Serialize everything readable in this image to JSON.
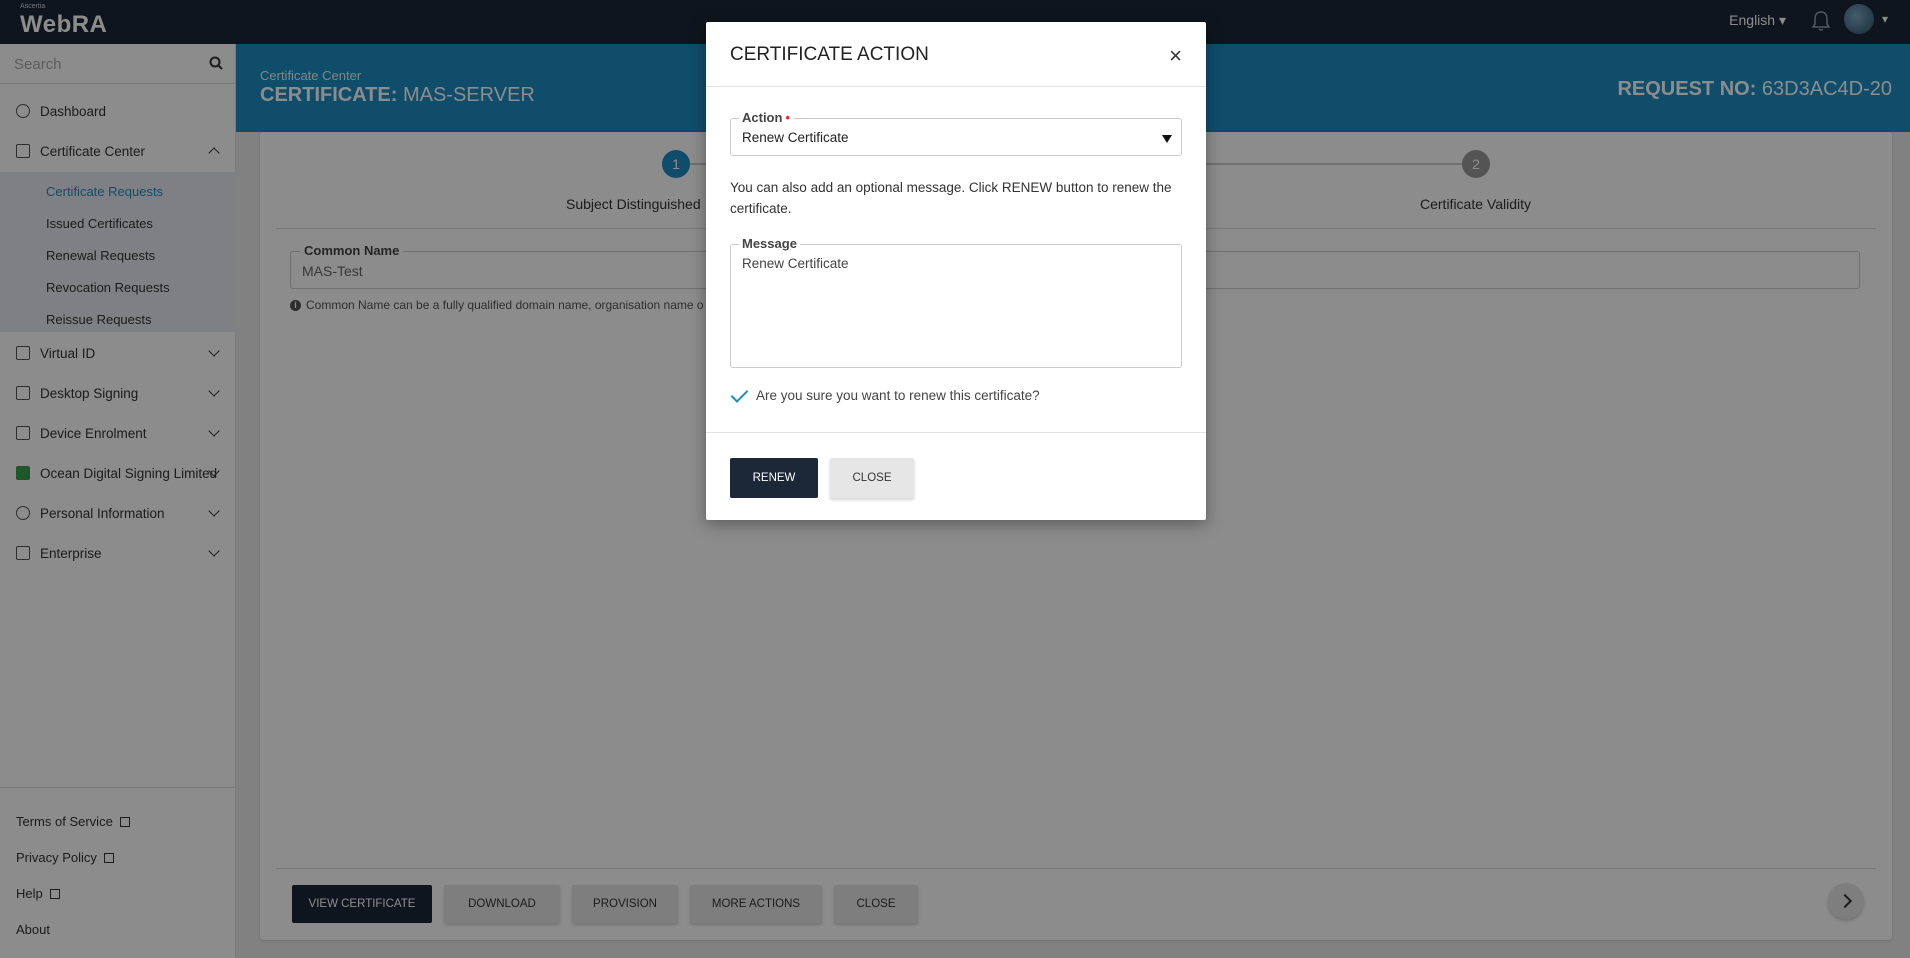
{
  "app": {
    "brand_small": "Ascertia",
    "brand_name": "WebRA",
    "language": "English ▾"
  },
  "sidebar": {
    "search_placeholder": "Search",
    "items": [
      {
        "label": "Dashboard"
      },
      {
        "label": "Certificate Center"
      },
      {
        "label": "Virtual ID"
      },
      {
        "label": "Desktop Signing"
      },
      {
        "label": "Device Enrolment"
      },
      {
        "label": "Ocean Digital Signing Limited"
      },
      {
        "label": "Personal Information"
      },
      {
        "label": "Enterprise"
      }
    ],
    "subitems": [
      {
        "label": "Certificate Requests"
      },
      {
        "label": "Issued Certificates"
      },
      {
        "label": "Renewal Requests"
      },
      {
        "label": "Revocation Requests"
      },
      {
        "label": "Reissue Requests"
      }
    ],
    "footer": [
      {
        "label": "Terms of Service"
      },
      {
        "label": "Privacy Policy"
      },
      {
        "label": "Help"
      },
      {
        "label": "About"
      }
    ]
  },
  "header": {
    "breadcrumb": "Certificate Center",
    "title_prefix": "CERTIFICATE:",
    "title_value": "MAS-SERVER",
    "request_prefix": "REQUEST NO:",
    "request_value": "63D3AC4D-20"
  },
  "wizard": {
    "steps": [
      {
        "number": "1",
        "label": "Subject Distinguished"
      },
      {
        "number": "2",
        "label": "Certificate Validity"
      }
    ],
    "common_name_label": "Common Name",
    "common_name_value": "MAS-Test",
    "common_name_help": "Common Name can be a fully qualified domain name, organisation name o"
  },
  "actions": {
    "view_certificate": "VIEW CERTIFICATE",
    "download": "DOWNLOAD",
    "provision": "PROVISION",
    "more_actions": "MORE ACTIONS",
    "close": "CLOSE"
  },
  "modal": {
    "title": "CERTIFICATE ACTION",
    "close_symbol": "×",
    "action_label": "Action",
    "required_mark": "•",
    "action_value": "Renew Certificate",
    "info_text": "You can also add an optional message. Click RENEW button to renew the certificate.",
    "message_label": "Message",
    "message_value": "Renew Certificate",
    "confirm_label": "Are you sure you want to renew this certificate?",
    "renew_button": "RENEW",
    "close_button": "CLOSE"
  },
  "colors": {
    "topbar": "#1c2737",
    "accent": "#1e8dc1",
    "dark_button": "#1c2737"
  }
}
